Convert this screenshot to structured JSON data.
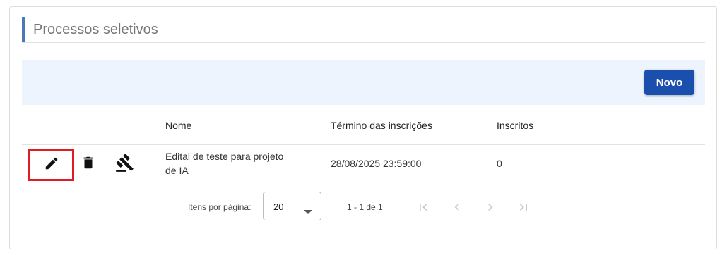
{
  "section": {
    "title": "Processos seletivos"
  },
  "toolbar": {
    "new_label": "Novo"
  },
  "table": {
    "columns": [
      "Nome",
      "Término das inscrições",
      "Inscritos"
    ],
    "rows": [
      {
        "name_line1": "Edital de teste para projeto",
        "name_line2": "de IA",
        "deadline": "28/08/2025 23:59:00",
        "enrolled": "0",
        "actions": [
          "edit-icon",
          "delete-icon",
          "gavel-icon"
        ]
      }
    ]
  },
  "paginator": {
    "items_per_page_label": "Itens por página:",
    "page_size": "20",
    "range": "1 - 1 de 1",
    "buttons": [
      "first-page-icon",
      "previous-page-icon",
      "next-page-icon",
      "last-page-icon"
    ]
  },
  "colors": {
    "accent_bar": "#4a78b8",
    "primary_button": "#1a4fae",
    "toolbar_bg": "#edf4fd",
    "highlight_box": "#e01b24"
  }
}
